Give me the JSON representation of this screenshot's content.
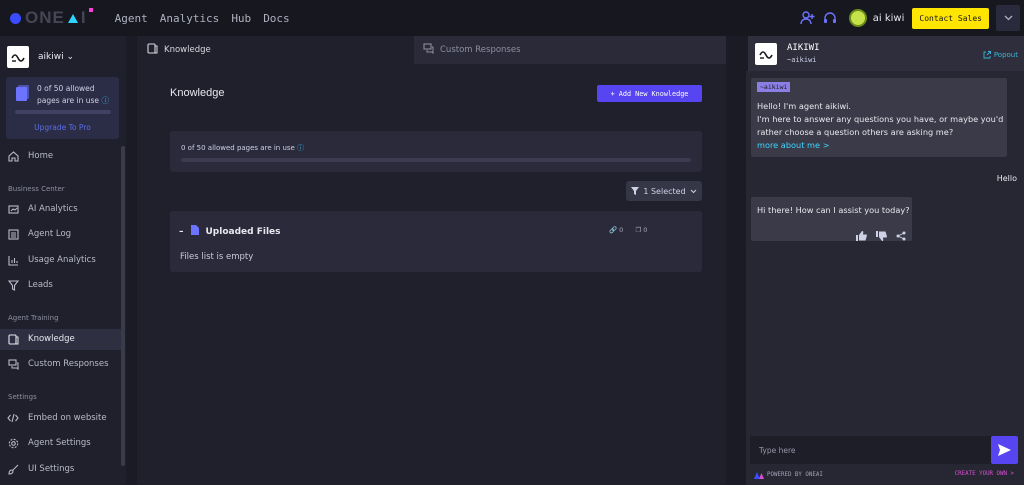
{
  "topbar": {
    "brand": "ONEAI",
    "nav": [
      "Agent",
      "Analytics",
      "Hub",
      "Docs"
    ],
    "user_name": "ai kiwi",
    "contact_label": "Contact Sales"
  },
  "sidebar": {
    "agent_name": "aikiwi",
    "quota_text": "0 of 50 allowed pages are in use",
    "upgrade_label": "Upgrade To Pro",
    "home": "Home",
    "section_business": "Business Center",
    "ai_analytics": "AI Analytics",
    "agent_log": "Agent Log",
    "usage_analytics": "Usage Analytics",
    "leads": "Leads",
    "section_training": "Agent Training",
    "knowledge": "Knowledge",
    "custom_responses": "Custom Responses",
    "section_settings": "Settings",
    "embed": "Embed on website",
    "agent_settings": "Agent Settings",
    "ui_settings": "UI Settings"
  },
  "main": {
    "tab_knowledge": "Knowledge",
    "tab_custom": "Custom Responses",
    "title": "Knowledge",
    "add_button": "+ Add New Knowledge",
    "usage_text": "0 of 50 allowed pages are in use",
    "usage_fraction": 0,
    "selected_label": "1 Selected",
    "uploaded_files": "Uploaded Files",
    "link_count": "0",
    "file_count": "0",
    "empty_text": "Files list is empty"
  },
  "chat": {
    "name": "AIKIWI",
    "handle": "~aikiwi",
    "popout": "Popout",
    "tag": "~aikiwi",
    "intro_line1": "Hello! I'm agent aikiwi.",
    "intro_line2": "I'm here to answer any questions you have, or maybe you'd rather choose a question others are asking me?",
    "more_link": "more about me >",
    "user_message": "Hello",
    "bot_reply": "Hi there! How can I assist you today?",
    "input_placeholder": "Type here",
    "powered_by": "POWERED BY ONEAI",
    "create_own": "CREATE YOUR OWN >"
  },
  "colors": {
    "accent": "#5645f0",
    "contact": "#ffe500",
    "link": "#3fd7ff"
  },
  "icons": [
    "add-user-icon",
    "headset-icon",
    "chevron-down-icon",
    "home-icon",
    "analytics-icon",
    "log-icon",
    "chart-icon",
    "filter-icon",
    "knowledge-icon",
    "chat-icon",
    "code-icon",
    "gear-icon",
    "brush-icon",
    "send-icon",
    "thumbs-up-icon",
    "thumbs-down-icon",
    "share-icon",
    "popout-icon"
  ]
}
